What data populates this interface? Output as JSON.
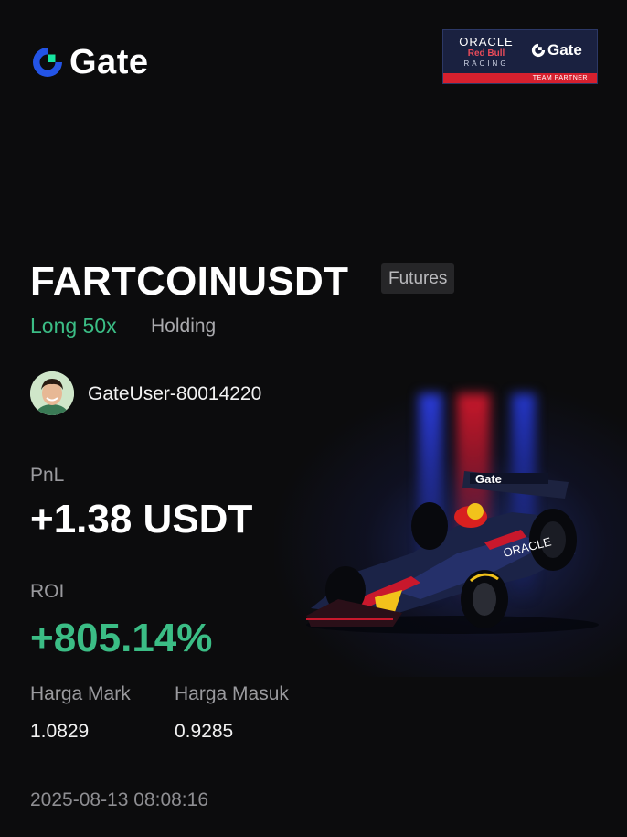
{
  "brand": {
    "name": "Gate",
    "accent": "#2354e6",
    "accent_green": "#17e6a1"
  },
  "partner": {
    "line1": "ORACLE",
    "line2": "Red Bull",
    "line3": "RACING",
    "gate": "Gate",
    "tag": "TEAM PARTNER",
    "strip_color": "#d6202e"
  },
  "position": {
    "symbol": "FARTCOINUSDT",
    "market_type": "Futures",
    "direction": "Long 50x",
    "status": "Holding"
  },
  "user": {
    "name": "GateUser-80014220"
  },
  "pnl": {
    "label": "PnL",
    "value": "+1.38 USDT"
  },
  "roi": {
    "label": "ROI",
    "value": "+805.14%"
  },
  "prices": {
    "mark_label": "Harga Mark",
    "mark_value": "1.0829",
    "entry_label": "Harga Masuk",
    "entry_value": "0.9285"
  },
  "timestamp": "2025-08-13 08:08:16",
  "car": {
    "livery": "Gate"
  },
  "colors": {
    "positive": "#3bbd85",
    "background": "#0c0c0d"
  }
}
